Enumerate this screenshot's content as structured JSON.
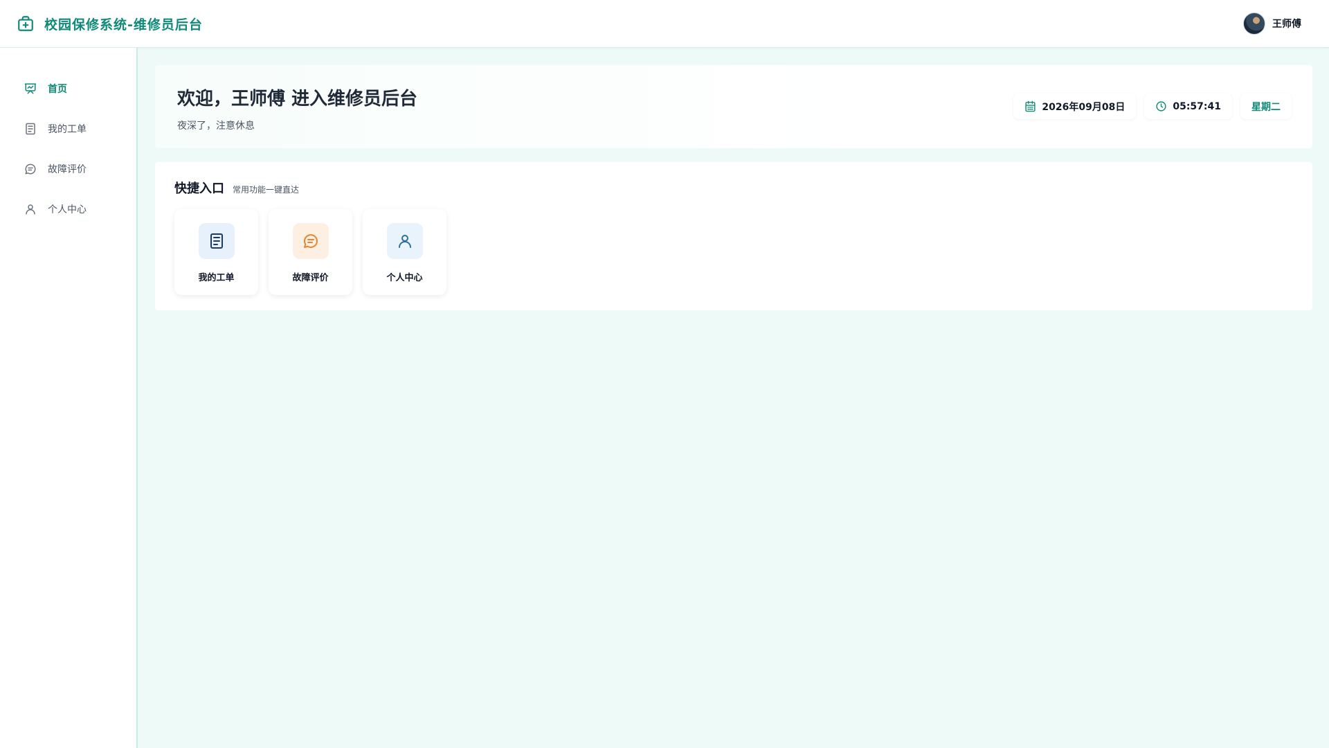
{
  "app": {
    "title": "校园保修系统-维修员后台"
  },
  "user": {
    "name": "王师傅"
  },
  "sidebar": {
    "items": [
      {
        "label": "首页",
        "icon": "presentation-icon",
        "active": true
      },
      {
        "label": "我的工单",
        "icon": "document-icon",
        "active": false
      },
      {
        "label": "故障评价",
        "icon": "chat-icon",
        "active": false
      },
      {
        "label": "个人中心",
        "icon": "user-icon",
        "active": false
      }
    ]
  },
  "welcome": {
    "title": "欢迎，王师傅 进入维修员后台",
    "subtitle": "夜深了，注意休息",
    "date": "2026年09月08日",
    "time": "05:57:41",
    "weekday": "星期二"
  },
  "quick": {
    "title": "快捷入口",
    "subtitle": "常用功能一键直达",
    "cards": [
      {
        "label": "我的工单",
        "icon": "document-icon",
        "color": "#1e3a5f"
      },
      {
        "label": "故障评价",
        "icon": "chat-icon",
        "color": "#e8842f"
      },
      {
        "label": "个人中心",
        "icon": "user-icon",
        "color": "#2b6f9e"
      }
    ]
  },
  "colors": {
    "accent": "#0f8a78",
    "background": "#eefaf7"
  }
}
